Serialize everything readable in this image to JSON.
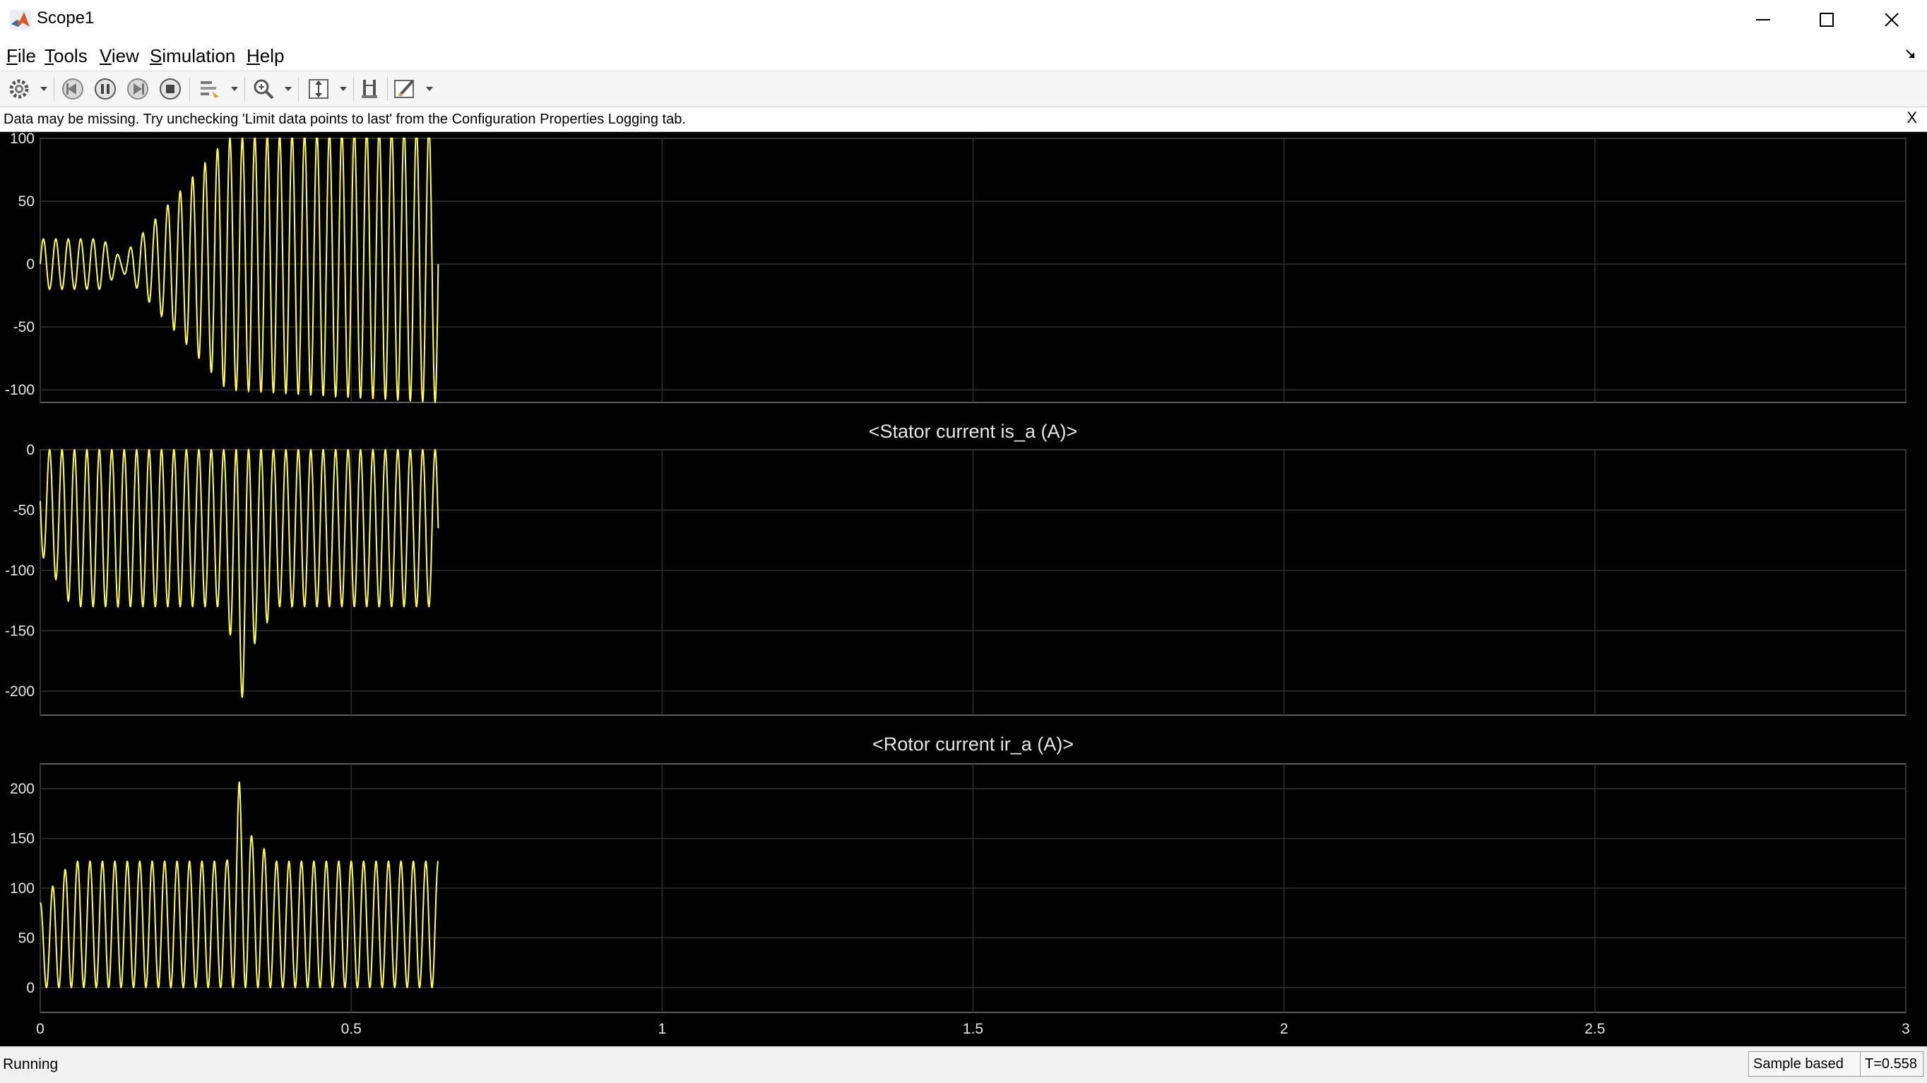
{
  "window": {
    "title": "Scope1"
  },
  "menu": {
    "items": [
      {
        "label": "File",
        "key": "F",
        "rest": "ile"
      },
      {
        "label": "Tools",
        "key": "T",
        "rest": "ools"
      },
      {
        "label": "View",
        "key": "V",
        "rest": "iew"
      },
      {
        "label": "Simulation",
        "key": "S",
        "rest": "imulation"
      },
      {
        "label": "Help",
        "key": "H",
        "rest": "elp"
      }
    ]
  },
  "toolbar": {
    "icons": [
      "gear-icon",
      "step-back-icon",
      "pause-icon",
      "step-forward-icon",
      "stop-icon",
      "highlight-icon",
      "zoom-icon",
      "scale-icon",
      "cursor-measure-icon",
      "style-icon"
    ]
  },
  "infobar": {
    "message": "Data may be missing.  Try unchecking 'Limit data points to last' from the Configuration Properties Logging tab.",
    "close_label": "X"
  },
  "colors": {
    "trace": "#ffff44",
    "axes_bg": "#000000",
    "grid": "#303030",
    "tick_text": "#e6e6e6",
    "title_text": "#e6e6e6"
  },
  "chart_data": [
    {
      "type": "line",
      "title": "",
      "xlim": [
        0,
        3
      ],
      "ylim": [
        -110,
        100
      ],
      "y_ticks": [
        100,
        50,
        0,
        -50,
        -100
      ],
      "x_ticks": [
        0,
        0.5,
        1,
        1.5,
        2,
        2.5,
        3
      ],
      "show_x_tick_labels": false,
      "grid": true,
      "data_end_x": 0.64,
      "series": [
        {
          "frequency_hz": 50,
          "envelope": [
            [
              0,
              20
            ],
            [
              0.1,
              20
            ],
            [
              0.13,
              5
            ],
            [
              0.3,
              100
            ],
            [
              0.64,
              110
            ]
          ],
          "clip": [
            -110,
            100
          ]
        }
      ]
    },
    {
      "type": "line",
      "title": "<Stator current is_a (A)>",
      "xlim": [
        0,
        3
      ],
      "ylim": [
        -220,
        0
      ],
      "y_ticks": [
        0,
        -50,
        -100,
        -150,
        -200
      ],
      "x_ticks": [
        0,
        0.5,
        1,
        1.5,
        2,
        2.5,
        3
      ],
      "show_x_tick_labels": false,
      "grid": true,
      "data_end_x": 0.64,
      "series": [
        {
          "frequency_hz": 50,
          "min_values": [
            [
              0,
              -85
            ],
            [
              0.05,
              -130
            ],
            [
              0.3,
              -130
            ],
            [
              0.32,
              -218
            ],
            [
              0.34,
              -165
            ],
            [
              0.38,
              -130
            ],
            [
              0.64,
              -130
            ]
          ],
          "max": 0
        }
      ]
    },
    {
      "type": "line",
      "title": "<Rotor current ir_a (A)>",
      "xlim": [
        0,
        3
      ],
      "ylim": [
        -25,
        225
      ],
      "y_ticks": [
        200,
        150,
        100,
        50,
        0
      ],
      "x_ticks": [
        0,
        0.5,
        1,
        1.5,
        2,
        2.5,
        3
      ],
      "x_tick_labels": [
        "0",
        "0.5",
        "1",
        "1.5",
        "2",
        "2.5",
        "3"
      ],
      "show_x_tick_labels": true,
      "grid": true,
      "data_end_x": 0.64,
      "series": [
        {
          "frequency_hz": 50,
          "max_values": [
            [
              0,
              85
            ],
            [
              0.05,
              127
            ],
            [
              0.3,
              127
            ],
            [
              0.32,
              207
            ],
            [
              0.34,
              152
            ],
            [
              0.38,
              127
            ],
            [
              0.64,
              127
            ]
          ],
          "min": 0
        }
      ]
    }
  ],
  "status": {
    "state": "Running",
    "mode": "Sample based",
    "time": "T=0.558"
  }
}
